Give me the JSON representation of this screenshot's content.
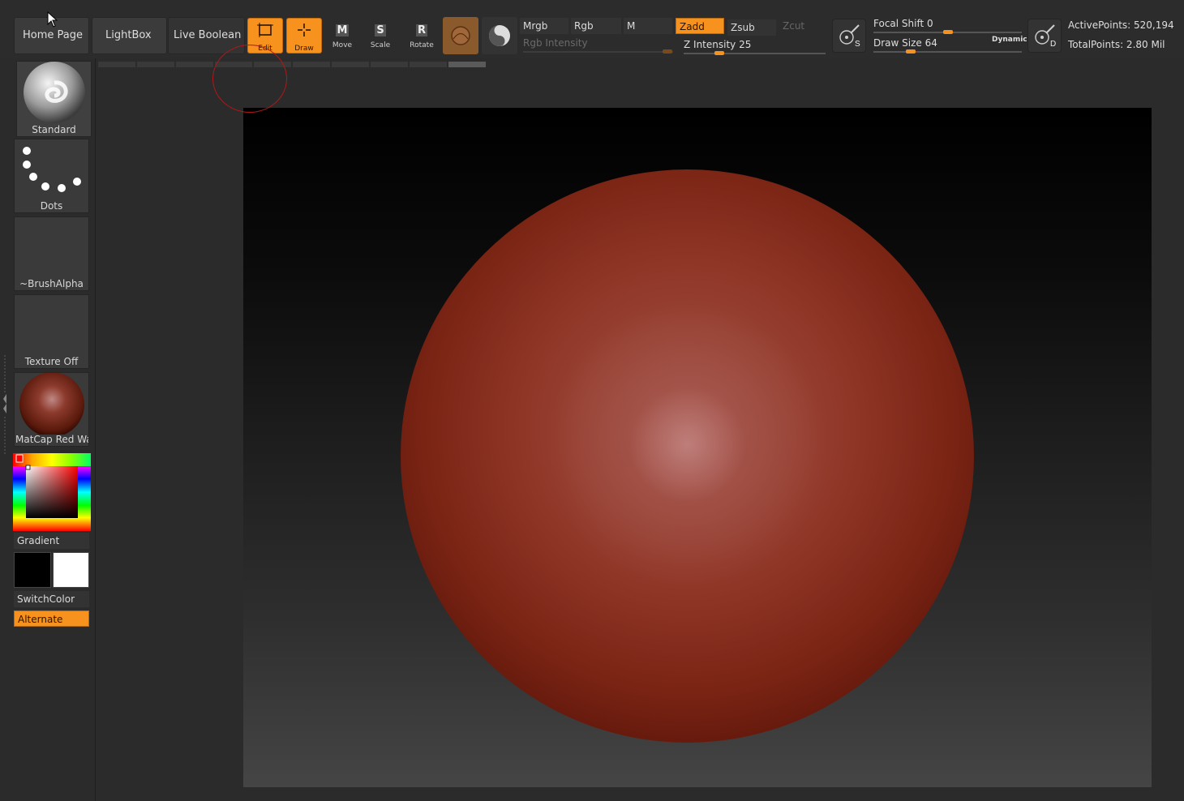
{
  "nav": {
    "home": "Home Page",
    "lightbox": "LightBox",
    "live_boolean": "Live Boolean"
  },
  "tools": {
    "edit": "Edit",
    "draw": "Draw",
    "move": "Move",
    "move_glyph": "M",
    "scale": "Scale",
    "scale_glyph": "S",
    "rotate": "Rotate",
    "rotate_glyph": "R"
  },
  "color_modes": {
    "mrgb": "Mrgb",
    "rgb": "Rgb",
    "m": "M",
    "rgb_intensity_label": "Rgb Intensity"
  },
  "z_modes": {
    "zadd": "Zadd",
    "zsub": "Zsub",
    "zcut": "Zcut",
    "z_intensity_label": "Z Intensity",
    "z_intensity_value": "25",
    "z_intensity_fraction": 0.25
  },
  "brush": {
    "focal_shift_label": "Focal Shift",
    "focal_shift_value": "0",
    "focal_shift_fraction": 0.5,
    "draw_size_label": "Draw Size",
    "draw_size_value": "64",
    "draw_size_fraction": 0.25,
    "dynamic_label": "Dynamic",
    "s_glyph": "S",
    "d_glyph": "D"
  },
  "stats": {
    "active_points": "ActivePoints: 520,194",
    "total_points": "TotalPoints: 2.80 Mil"
  },
  "left_panel": {
    "brush_label": "Standard",
    "stroke_label": "Dots",
    "alpha_label": "~BrushAlpha",
    "texture_label": "Texture Off",
    "material_label": "MatCap Red Wax",
    "gradient_label": "Gradient",
    "switch_color_label": "SwitchColor",
    "alternate_label": "Alternate"
  },
  "colors": {
    "accent": "#f7921e",
    "main_color": "#000000",
    "secondary_color": "#ffffff",
    "material": "#8f3526"
  }
}
